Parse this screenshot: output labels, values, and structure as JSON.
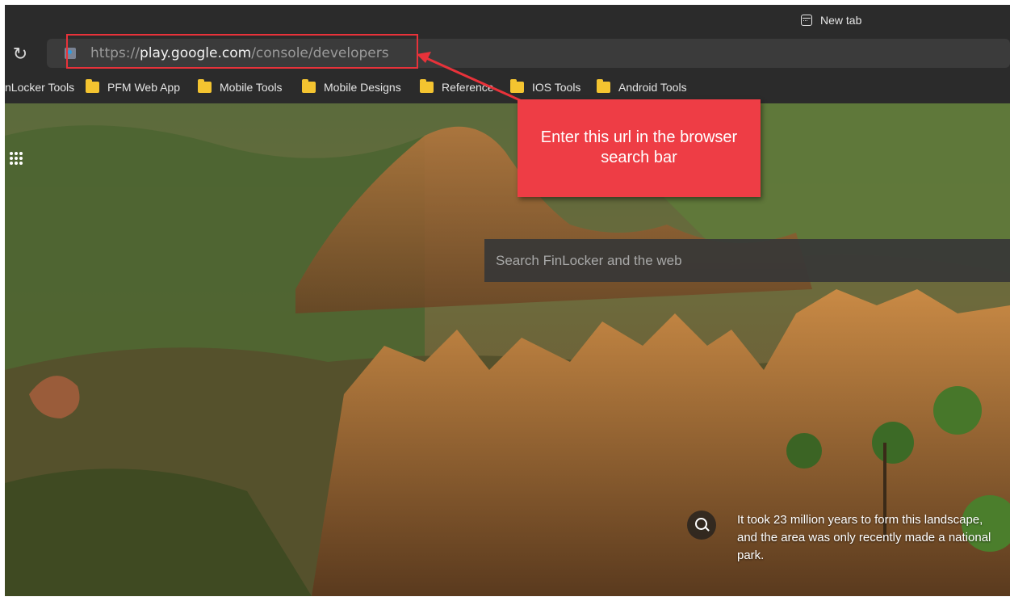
{
  "tab": {
    "title": "New tab",
    "icon": "new-tab-icon"
  },
  "toolbar": {
    "reload_icon": "reload-icon",
    "address": {
      "scheme": "https://",
      "host": "play.google.com",
      "path": "/console/developers"
    }
  },
  "bookmarks": [
    {
      "label": "nLocker Tools",
      "icon": "none"
    },
    {
      "label": "PFM Web App",
      "icon": "folder-icon"
    },
    {
      "label": "Mobile Tools",
      "icon": "folder-icon"
    },
    {
      "label": "Mobile Designs",
      "icon": "folder-icon"
    },
    {
      "label": "Reference",
      "icon": "folder-icon"
    },
    {
      "label": "IOS Tools",
      "icon": "folder-icon"
    },
    {
      "label": "Android Tools",
      "icon": "folder-icon"
    }
  ],
  "newtab": {
    "search_placeholder": "Search FinLocker and the web",
    "image_caption": "It took 23 million years to form this landscape, and the area was only recently made a national park."
  },
  "annotation": {
    "callout_text": "Enter this url in the browser search bar",
    "color": "#ee3d45"
  }
}
